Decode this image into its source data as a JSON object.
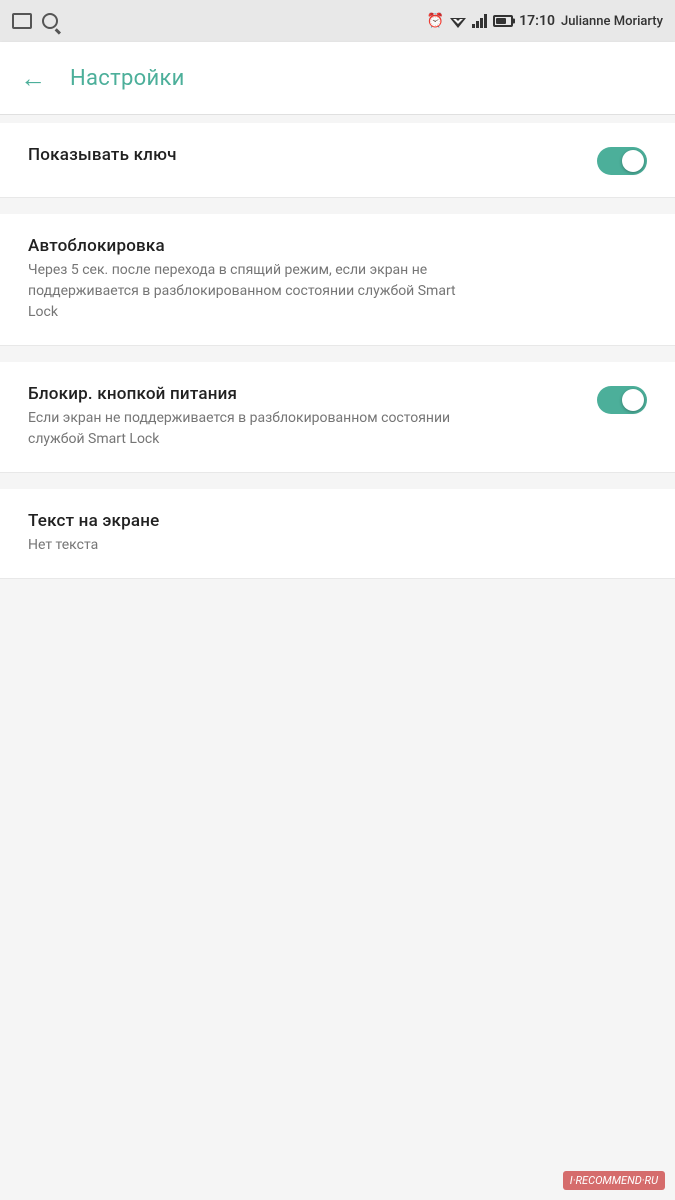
{
  "statusBar": {
    "user": "Julianne Moriarty",
    "time": "17:10"
  },
  "appBar": {
    "title": "Настройки",
    "backLabel": "←"
  },
  "settings": [
    {
      "id": "show-key",
      "title": "Показывать ключ",
      "subtitle": "",
      "toggleState": "on"
    },
    {
      "id": "autoblock",
      "title": "Автоблокировка",
      "subtitle": "Через 5 сек. после перехода в спящий режим, если экран не поддерживается в разблокированном состоянии службой Smart Lock",
      "toggleState": "none"
    },
    {
      "id": "block-power",
      "title": "Блокир. кнопкой питания",
      "subtitle": "Если экран не поддерживается в разблокированном состоянии службой Smart Lock",
      "toggleState": "on"
    },
    {
      "id": "screen-text",
      "title": "Текст на экране",
      "subtitle": "Нет текста",
      "toggleState": "none"
    }
  ],
  "watermark": "I·RECOMMEND·RU"
}
